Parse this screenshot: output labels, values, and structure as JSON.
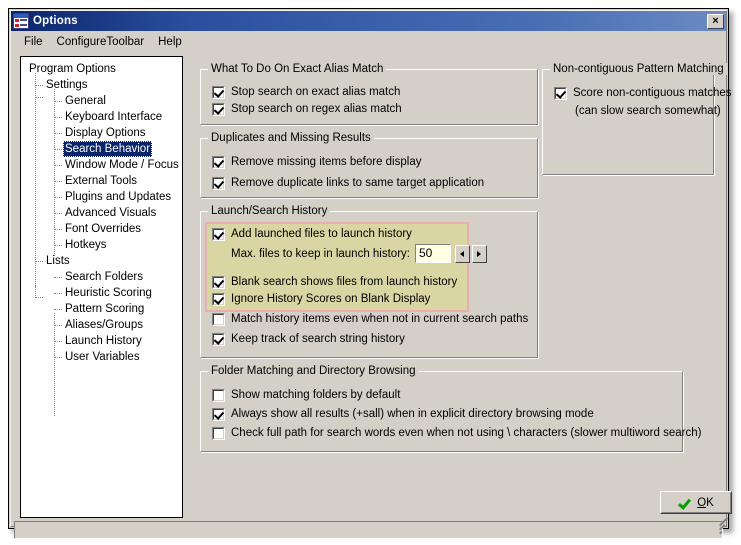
{
  "window": {
    "title": "Options",
    "icon": "options-list-icon",
    "close_label": "×"
  },
  "menubar": {
    "items": [
      {
        "label": "File"
      },
      {
        "label": "ConfigureToolbar"
      },
      {
        "label": "Help"
      }
    ]
  },
  "tree": {
    "nodes": [
      {
        "label": "Program Options",
        "level": 0,
        "selected": false
      },
      {
        "label": "Settings",
        "level": 1,
        "selected": false
      },
      {
        "label": "General",
        "level": 2,
        "selected": false
      },
      {
        "label": "Keyboard Interface",
        "level": 2,
        "selected": false
      },
      {
        "label": "Display Options",
        "level": 2,
        "selected": false
      },
      {
        "label": "Search Behavior",
        "level": 2,
        "selected": true
      },
      {
        "label": "Window Mode / Focus",
        "level": 2,
        "selected": false
      },
      {
        "label": "External Tools",
        "level": 2,
        "selected": false
      },
      {
        "label": "Plugins and Updates",
        "level": 2,
        "selected": false
      },
      {
        "label": "Advanced Visuals",
        "level": 2,
        "selected": false
      },
      {
        "label": "Font Overrides",
        "level": 2,
        "selected": false
      },
      {
        "label": "Hotkeys",
        "level": 2,
        "selected": false
      },
      {
        "label": "Lists",
        "level": 1,
        "selected": false
      },
      {
        "label": "Search Folders",
        "level": 2,
        "selected": false
      },
      {
        "label": "Heuristic Scoring",
        "level": 2,
        "selected": false
      },
      {
        "label": "Pattern Scoring",
        "level": 2,
        "selected": false
      },
      {
        "label": "Aliases/Groups",
        "level": 2,
        "selected": false
      },
      {
        "label": "Launch History",
        "level": 2,
        "selected": false
      },
      {
        "label": "User Variables",
        "level": 2,
        "selected": false
      }
    ]
  },
  "groups": {
    "exact_alias": {
      "title": "What To Do On Exact Alias Match",
      "options": [
        {
          "label": "Stop search on exact alias match",
          "checked": true
        },
        {
          "label": "Stop search on regex alias match",
          "checked": true
        }
      ]
    },
    "duplicates": {
      "title": "Duplicates and Missing Results",
      "options": [
        {
          "label": "Remove missing items before display",
          "checked": true
        },
        {
          "label": "Remove duplicate links to same target application",
          "checked": true
        }
      ]
    },
    "history": {
      "title": "Launch/Search History",
      "options": [
        {
          "label": "Add launched files to launch history",
          "checked": true
        },
        {
          "label": "Blank search shows files from launch history",
          "checked": true
        },
        {
          "label": "Ignore History Scores on Blank Display",
          "checked": true
        },
        {
          "label": "Match history items even when not in current search paths",
          "checked": false
        },
        {
          "label": "Keep track of search string history",
          "checked": true
        }
      ],
      "spinner": {
        "label": "Max. files to keep in launch history:",
        "value": "50",
        "decrement": "◄",
        "increment": "►"
      },
      "highlight_color": "#d9d6a4",
      "highlight_border_color": "#e8afae"
    },
    "folder_matching": {
      "title": "Folder Matching and Directory Browsing",
      "options": [
        {
          "label": "Show matching folders by default",
          "checked": false
        },
        {
          "label": "Always show all results (+sall) when in explicit directory browsing mode",
          "checked": true
        },
        {
          "label": "Check full path for search words even when not using \\ characters (slower multiword search)",
          "checked": false
        }
      ]
    },
    "noncontiguous": {
      "title": "Non-contiguous Pattern Matching",
      "options": [
        {
          "label": "Score non-contiguous matches",
          "checked": true
        }
      ],
      "note": "(can slow search somewhat)"
    }
  },
  "footer": {
    "ok_button": {
      "mnemonic": "O",
      "rest": "K",
      "icon": "green-check-icon"
    }
  },
  "colors": {
    "window_face": "#d4d0c8",
    "titlebar_start": "#0a246a",
    "titlebar_end": "#6d8bc4",
    "selection": "#0a246a",
    "edit_field": "#ffffe1"
  }
}
